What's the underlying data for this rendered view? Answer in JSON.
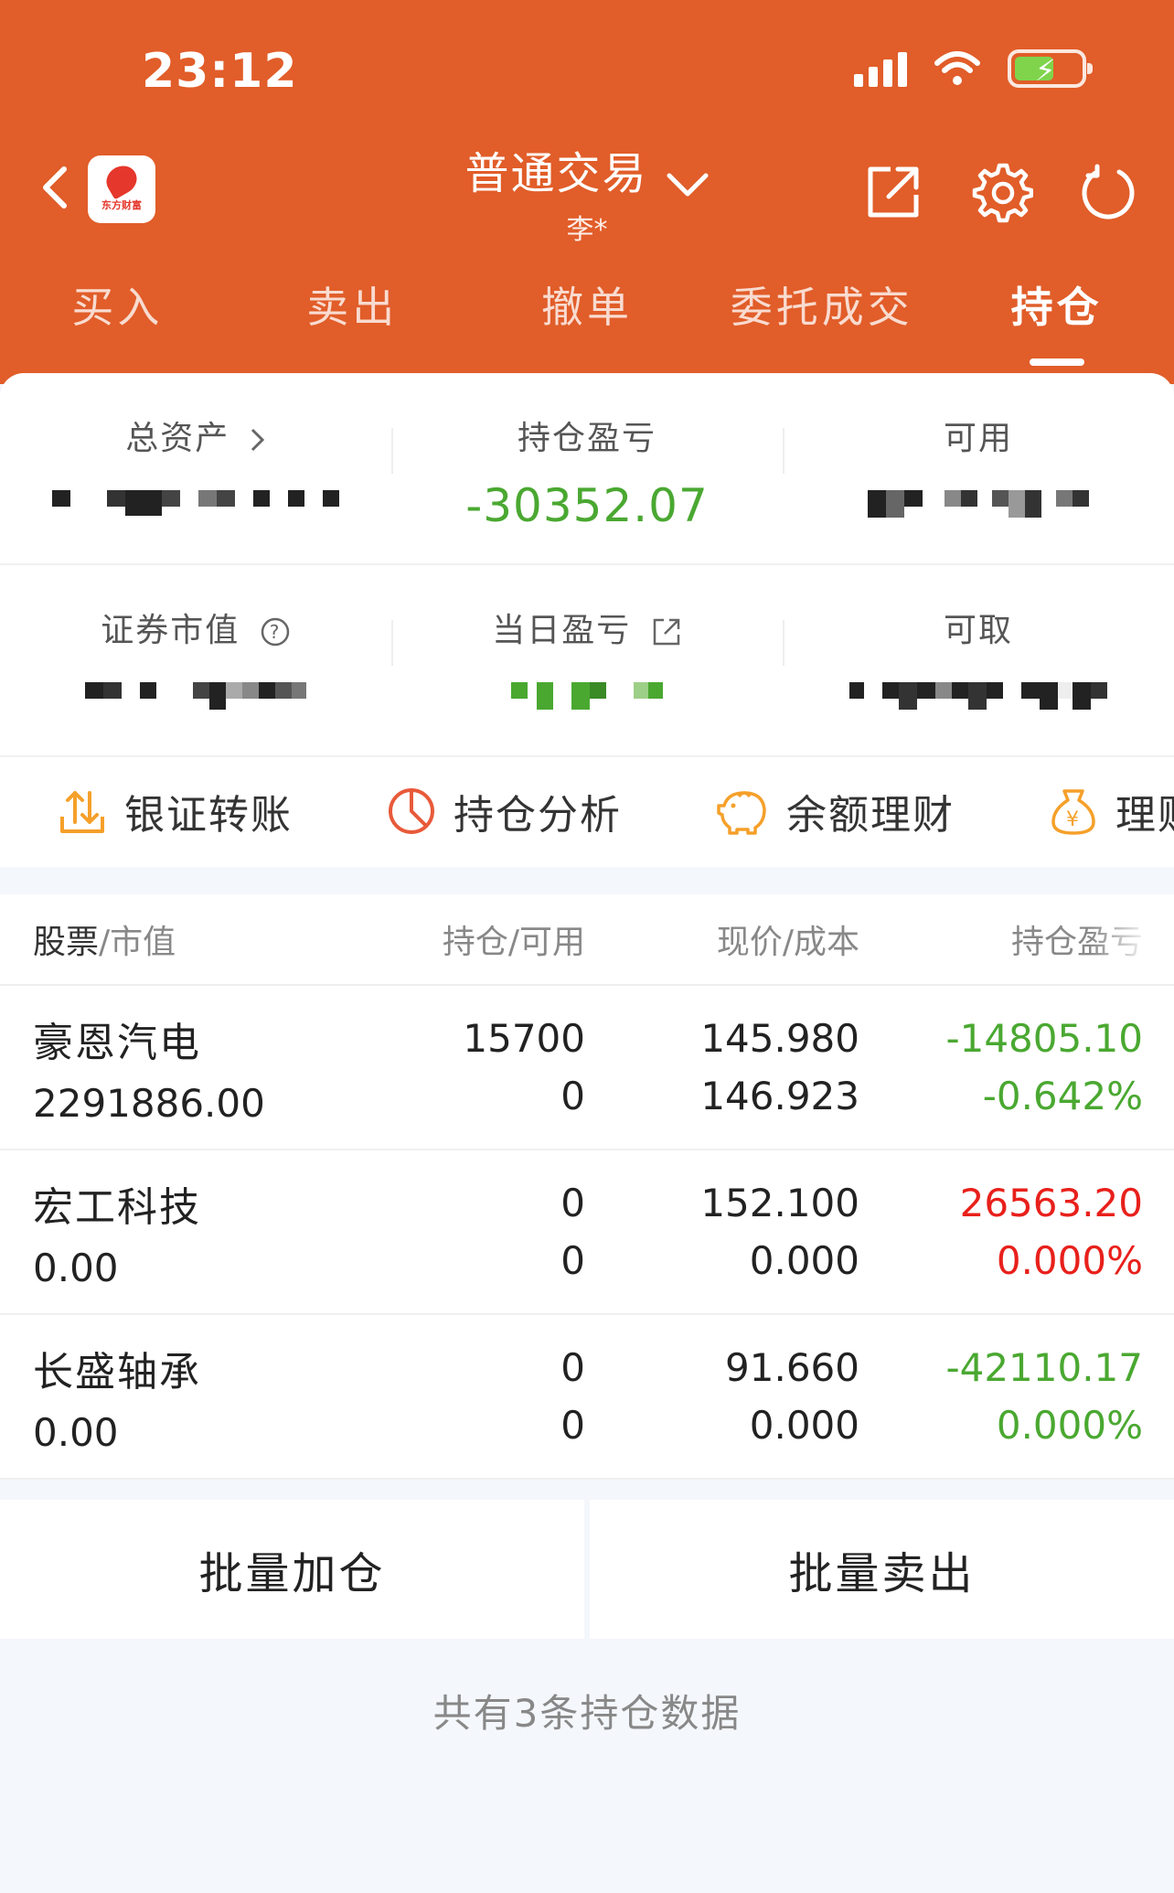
{
  "status": {
    "time": "23:12"
  },
  "header": {
    "title": "普通交易",
    "subtitle": "李*",
    "logo_text": "东方财富",
    "accent_color": "#e15d29"
  },
  "tabs": [
    {
      "label": "买入",
      "active": false
    },
    {
      "label": "卖出",
      "active": false
    },
    {
      "label": "撤单",
      "active": false
    },
    {
      "label": "委托成交",
      "active": false
    },
    {
      "label": "持仓",
      "active": true
    }
  ],
  "summary": {
    "total_assets_label": "总资产",
    "position_pl_label": "持仓盈亏",
    "position_pl_value": "-30352.07",
    "available_label": "可用",
    "market_value_label": "证券市值",
    "daily_pl_label": "当日盈亏",
    "withdrawable_label": "可取"
  },
  "quick_actions": [
    {
      "label": "银证转账",
      "icon": "transfer-icon"
    },
    {
      "label": "持仓分析",
      "icon": "pie-chart-icon"
    },
    {
      "label": "余额理财",
      "icon": "piggy-bank-icon"
    },
    {
      "label": "理财",
      "icon": "money-bag-icon"
    }
  ],
  "table": {
    "headers": {
      "stock": "股票",
      "market_value": "/市值",
      "holding": "持仓/可用",
      "price": "现价/成本",
      "pl": "持仓盈亏"
    },
    "rows": [
      {
        "name": "豪恩汽电",
        "market_value": "2291886.00",
        "holding": "15700",
        "available": "0",
        "price": "145.980",
        "cost": "146.923",
        "pl": "-14805.10",
        "pl_pct": "-0.642%",
        "color": "green"
      },
      {
        "name": "宏工科技",
        "market_value": "0.00",
        "holding": "0",
        "available": "0",
        "price": "152.100",
        "cost": "0.000",
        "pl": "26563.20",
        "pl_pct": "0.000%",
        "color": "red"
      },
      {
        "name": "长盛轴承",
        "market_value": "0.00",
        "holding": "0",
        "available": "0",
        "price": "91.660",
        "cost": "0.000",
        "pl": "-42110.17",
        "pl_pct": "0.000%",
        "color": "green"
      }
    ]
  },
  "actions": {
    "batch_add": "批量加仓",
    "batch_sell": "批量卖出"
  },
  "footer": {
    "note": "共有3条持仓数据"
  },
  "colors": {
    "gain": "#e8201b",
    "loss": "#4aa831"
  }
}
